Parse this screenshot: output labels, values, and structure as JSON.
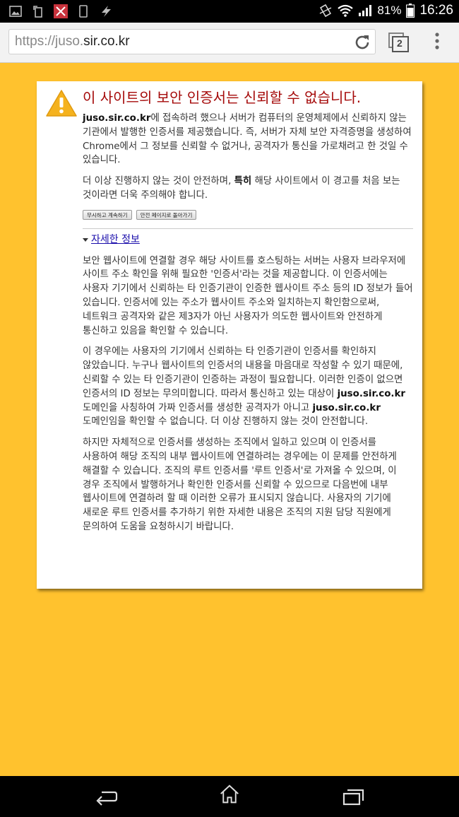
{
  "status_bar": {
    "battery": "81%",
    "time": "16:26",
    "left_icons": [
      "image-icon",
      "screen-rotate-icon",
      "app-icon",
      "phone-icon",
      "flash-icon"
    ],
    "right_icons": [
      "vibrate-icon",
      "wifi-icon",
      "signal-icon",
      "battery-icon"
    ]
  },
  "browser": {
    "url_scheme": "https://juso.",
    "url_host": "sir.co.kr",
    "tab_count": "2"
  },
  "interstitial": {
    "title": "이 사이트의 보안 인증서는 신뢰할 수 없습니다.",
    "p1_bold": "juso.sir.co.kr",
    "p1_rest": "에 접속하려 했으나 서버가 컴퓨터의 운영체제에서 신뢰하지 않는 기관에서 발행한 인증서를 제공했습니다. 즉, 서버가 자체 보안 자격증명을 생성하여 Chrome에서 그 정보를 신뢰할 수 없거나, 공격자가 통신을 가로채려고 한 것일 수 있습니다.",
    "p2_a": "더 이상 진행하지 않는 것이 안전하며, ",
    "p2_bold": "특히",
    "p2_b": " 해당 사이트에서 이 경고를 처음 보는 것이라면 더욱 주의해야 합니다.",
    "proceed_button": "무시하고 계속하기",
    "back_button": "안전 페이지로 돌아가기",
    "details_link": "자세한 정보",
    "d1": "보안 웹사이트에 연결할 경우 해당 사이트를 호스팅하는 서버는 사용자 브라우저에 사이트 주소 확인을 위해 필요한 '인증서'라는 것을 제공합니다. 이 인증서에는 사용자 기기에서 신뢰하는 타 인증기관이 인증한 웹사이트 주소 등의 ID 정보가 들어 있습니다. 인증서에 있는 주소가 웹사이트 주소와 일치하는지 확인함으로써, 네트워크 공격자와 같은 제3자가 아닌 사용자가 의도한 웹사이트와 안전하게 통신하고 있음을 확인할 수 있습니다.",
    "d2_a": "이 경우에는 사용자의 기기에서 신뢰하는 타 인증기관이 인증서를 확인하지 않았습니다. 누구나 웹사이트의 인증서의 내용을 마음대로 작성할 수 있기 때문에, 신뢰할 수 있는 타 인증기관이 인증하는 과정이 필요합니다. 이러한 인증이 없으면 인증서의 ID 정보는 무의미합니다. 따라서 통신하고 있는 대상이 ",
    "d2_bold1": "juso.sir.co.kr",
    "d2_b": " 도메인을 사칭하여 가짜 인증서를 생성한 공격자가 아니고 ",
    "d2_bold2": "juso.sir.co.kr",
    "d2_c": " 도메인임을 확인할 수 없습니다. 더 이상 진행하지 않는 것이 안전합니다.",
    "d3": "하지만 자체적으로 인증서를 생성하는 조직에서 일하고 있으며 이 인증서를 사용하여 해당 조직의 내부 웹사이트에 연결하려는 경우에는 이 문제를 안전하게 해결할 수 있습니다. 조직의 루트 인증서를 '루트 인증서'로 가져올 수 있으며, 이 경우 조직에서 발행하거나 확인한 인증서를 신뢰할 수 있으므로 다음번에 내부 웹사이트에 연결하려 할 때 이러한 오류가 표시되지 않습니다. 사용자의 기기에 새로운 루트 인증서를 추가하기 위한 자세한 내용은 조직의 지원 담당 직원에게 문의하여 도움을 요청하시기 바랍니다."
  },
  "nav_bar": {
    "icons": [
      "back-icon",
      "home-icon",
      "recents-icon"
    ]
  },
  "colors": {
    "page_background": "#ffc22e",
    "title_red": "#a50a0a",
    "link_blue": "#1a0dab"
  }
}
